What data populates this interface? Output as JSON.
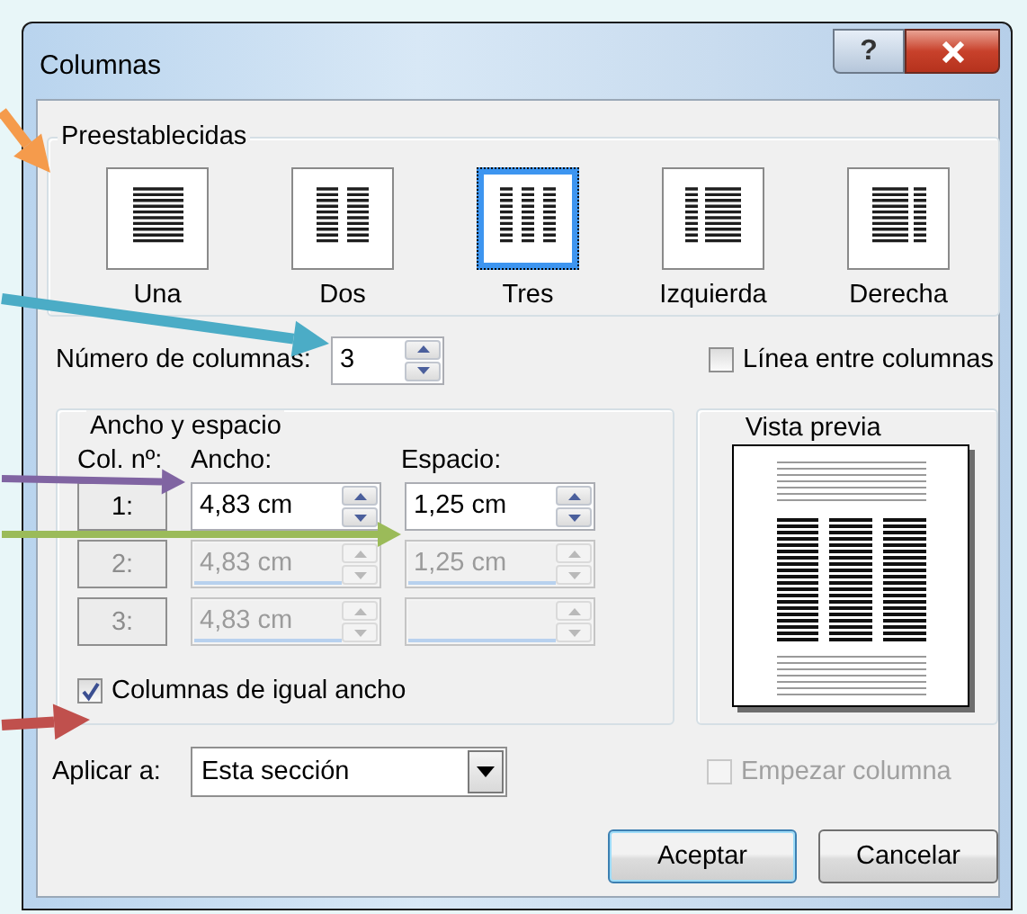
{
  "window": {
    "title": "Columnas",
    "help_button": "?"
  },
  "presets": {
    "title": "Preestablecidas",
    "items": [
      {
        "label": "Una",
        "kind": "one",
        "selected": false
      },
      {
        "label": "Dos",
        "kind": "two",
        "selected": false
      },
      {
        "label": "Tres",
        "kind": "three",
        "selected": true
      },
      {
        "label": "Izquierda",
        "kind": "left",
        "selected": false
      },
      {
        "label": "Derecha",
        "kind": "right",
        "selected": false
      }
    ]
  },
  "number_of_columns": {
    "label": "Número de columnas:",
    "value": "3"
  },
  "line_between": {
    "label": "Línea entre columnas",
    "checked": false
  },
  "width_spacing": {
    "title": "Ancho y espacio",
    "columns": [
      "Col. nº:",
      "Ancho:",
      "Espacio:"
    ],
    "rows": [
      {
        "number": "1:",
        "width": "4,83 cm",
        "spacing": "1,25 cm",
        "disabled": false
      },
      {
        "number": "2:",
        "width": "4,83 cm",
        "spacing": "1,25 cm",
        "disabled": true
      },
      {
        "number": "3:",
        "width": "4,83 cm",
        "disabled": true
      }
    ]
  },
  "equal_width": {
    "label": "Columnas de igual ancho",
    "checked": true
  },
  "preview": {
    "title": "Vista previa"
  },
  "apply_to": {
    "label": "Aplicar a:",
    "value": "Esta sección"
  },
  "start_column": {
    "label": "Empezar columna",
    "checked": false,
    "disabled": true
  },
  "buttons": [
    {
      "label": "Aceptar",
      "default": true
    },
    {
      "label": "Cancelar",
      "default": false
    }
  ],
  "annotations": [
    {
      "color": "#f59b4c"
    },
    {
      "color": "#4bacc6"
    },
    {
      "color": "#8064a2"
    },
    {
      "color": "#9bbb59"
    },
    {
      "color": "#c0504d"
    }
  ]
}
